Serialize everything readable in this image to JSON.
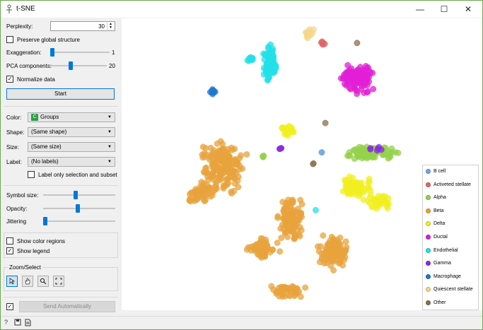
{
  "window": {
    "title": "t-SNE",
    "controls": {
      "minimize": "—",
      "maximize": "☐",
      "close": "✕"
    }
  },
  "params": {
    "perplexity_label": "Perplexity:",
    "perplexity_value": "30",
    "preserve_global_label": "Preserve global structure",
    "preserve_global_checked": false,
    "exaggeration_label": "Exaggeration:",
    "exaggeration_value": "1",
    "exaggeration_level": 0.0,
    "pca_label": "PCA components:",
    "pca_value": "20",
    "pca_level": 0.35,
    "normalize_label": "Normalize data",
    "normalize_checked": true,
    "start_label": "Start"
  },
  "attributes": {
    "color_label": "Color:",
    "color_value": "Groups",
    "color_badge": "C",
    "shape_label": "Shape:",
    "shape_value": "(Same shape)",
    "size_label": "Size:",
    "size_value": "(Same size)",
    "label_label": "Label:",
    "label_value": "(No labels)",
    "label_only_selection": "Label only selection and subset",
    "label_only_checked": false
  },
  "visual": {
    "symbol_size_label": "Symbol size:",
    "symbol_size_level": 0.45,
    "opacity_label": "Opacity:",
    "opacity_level": 0.48,
    "jittering_label": "Jittering",
    "jittering_level": 0.0
  },
  "options": {
    "show_color_regions": "Show color regions",
    "show_color_regions_checked": false,
    "show_legend": "Show legend",
    "show_legend_checked": true
  },
  "zoom": {
    "title": "Zoom/Select"
  },
  "footer": {
    "send_auto_label": "Send Automatically",
    "send_auto_checked": true
  },
  "legend": {
    "items": [
      {
        "label": "B cell",
        "color": "#6fa8dc"
      },
      {
        "label": "Activeted stellate",
        "color": "#e06666"
      },
      {
        "label": "Alpha",
        "color": "#93d14b"
      },
      {
        "label": "Beta",
        "color": "#e8a33d"
      },
      {
        "label": "Delta",
        "color": "#f2ef22"
      },
      {
        "label": "Ductal",
        "color": "#e21fd6"
      },
      {
        "label": "Endothelial",
        "color": "#22e0e8"
      },
      {
        "label": "Gamma",
        "color": "#8a2be2"
      },
      {
        "label": "Macrophage",
        "color": "#1f78d1"
      },
      {
        "label": "Quiescent stellate",
        "color": "#f5d58a"
      },
      {
        "label": "Other",
        "color": "#8b6f4e"
      }
    ]
  }
}
